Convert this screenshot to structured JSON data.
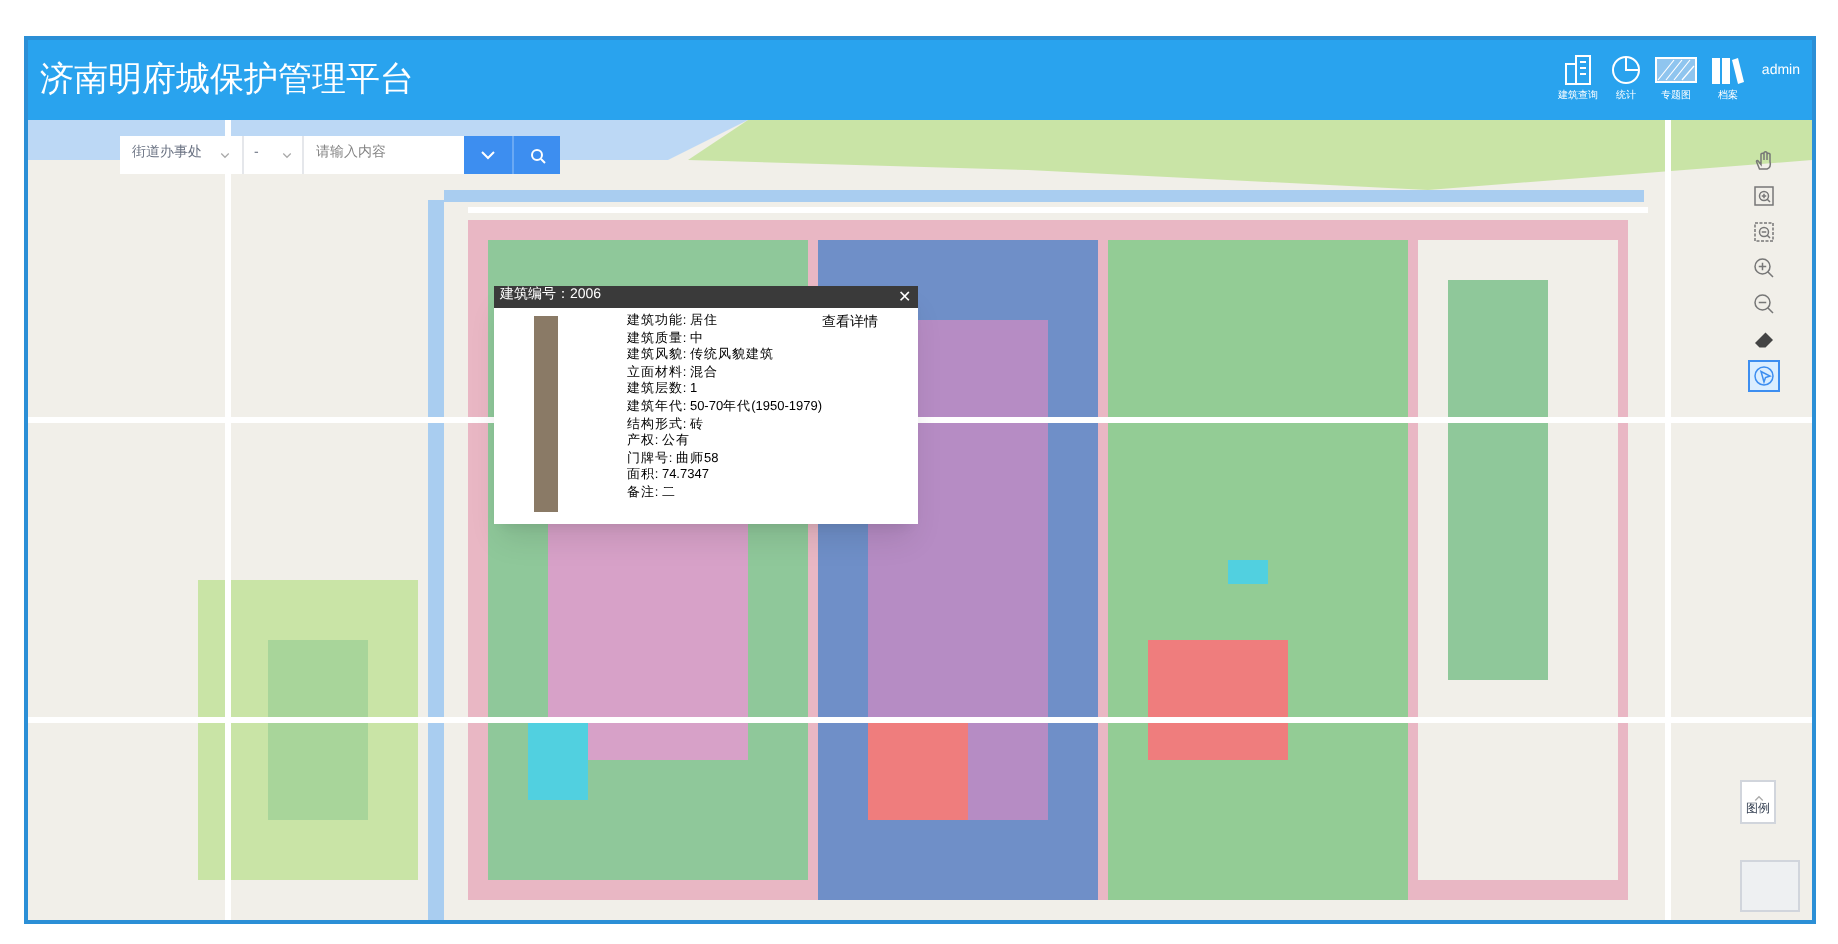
{
  "header": {
    "title": "济南明府城保护管理平台",
    "nav": [
      {
        "kind": "building",
        "label": "建筑查询"
      },
      {
        "kind": "pie",
        "label": "统计"
      },
      {
        "kind": "theme",
        "label": "专题图"
      },
      {
        "kind": "archive",
        "label": "档案"
      }
    ],
    "user": "admin"
  },
  "search": {
    "district": "街道办事处",
    "subdistrict": "-",
    "placeholder": "请输入内容"
  },
  "popup": {
    "title": "建筑编号：2006",
    "close": "✕",
    "details_link": "查看详情",
    "fields": [
      "建筑功能: 居住",
      "建筑质量: 中",
      "建筑风貌: 传统风貌建筑",
      "立面材料: 混合",
      "建筑层数: 1",
      "建筑年代: 50-70年代(1950-1979)",
      "结构形式: 砖",
      "产权: 公有",
      "门牌号: 曲师58",
      "面积: 74.7347",
      "备注: 二"
    ]
  },
  "tools": [
    {
      "kind": "pan",
      "selected": false
    },
    {
      "kind": "zoom-box-in",
      "selected": false
    },
    {
      "kind": "zoom-box-out",
      "selected": false
    },
    {
      "kind": "zoom-in",
      "selected": false
    },
    {
      "kind": "zoom-out",
      "selected": false
    },
    {
      "kind": "eraser",
      "selected": false
    },
    {
      "kind": "pointer",
      "selected": true
    }
  ],
  "legend_button": "图例"
}
